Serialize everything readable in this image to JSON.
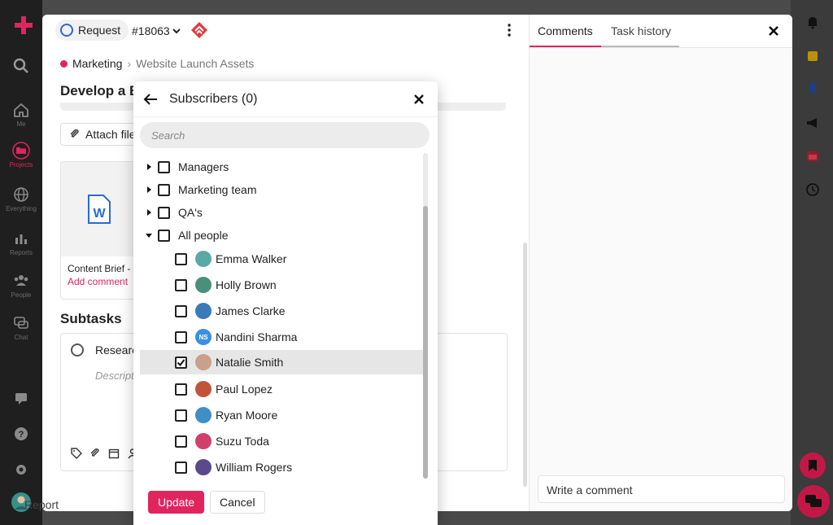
{
  "colors": {
    "accent": "#e0245e",
    "link_blue": "#2a6ad0"
  },
  "sidebar": {
    "items": [
      {
        "label": "Me",
        "icon": "home-icon"
      },
      {
        "label": "Projects",
        "icon": "folder-icon"
      },
      {
        "label": "Everything",
        "icon": "globe-icon"
      },
      {
        "label": "Reports",
        "icon": "chart-icon"
      },
      {
        "label": "People",
        "icon": "people-icon"
      },
      {
        "label": "Chat",
        "icon": "chat-icon"
      }
    ]
  },
  "task": {
    "type_label": "Request",
    "number": "#18063",
    "breadcrumb": {
      "project": "Marketing",
      "folder": "Website Launch Assets"
    },
    "title": "Develop a B",
    "attach_label": "Attach file",
    "file": {
      "name": "Content Brief -",
      "add_comment": "Add comment"
    },
    "subtasks_heading": "Subtasks",
    "subtask": {
      "title": "Research",
      "description_placeholder": "Descripti"
    },
    "report_label": "Report"
  },
  "panel": {
    "tabs": [
      {
        "label": "Comments"
      },
      {
        "label": "Task history"
      }
    ],
    "comment_placeholder": "Write a comment"
  },
  "modal": {
    "title": "Subscribers (0)",
    "search_placeholder": "Search",
    "groups": [
      {
        "label": "Managers",
        "expanded": false
      },
      {
        "label": "Marketing team",
        "expanded": false
      },
      {
        "label": "QA's",
        "expanded": false
      },
      {
        "label": "All people",
        "expanded": true
      }
    ],
    "people": [
      {
        "name": "Emma Walker",
        "checked": false,
        "avatar_color": "#5aa9a6"
      },
      {
        "name": "Holly Brown",
        "checked": false,
        "avatar_color": "#4a8f7a"
      },
      {
        "name": "James Clarke",
        "checked": false,
        "avatar_color": "#3a7ab8"
      },
      {
        "name": "Nandini Sharma",
        "checked": false,
        "avatar_color": "#3c8fe0",
        "initials": "NS"
      },
      {
        "name": "Natalie Smith",
        "checked": true,
        "avatar_color": "#c9a08a"
      },
      {
        "name": "Paul Lopez",
        "checked": false,
        "avatar_color": "#c0543a"
      },
      {
        "name": "Ryan Moore",
        "checked": false,
        "avatar_color": "#3f8fc6"
      },
      {
        "name": "Suzu Toda",
        "checked": false,
        "avatar_color": "#d0406a"
      },
      {
        "name": "William Rogers",
        "checked": false,
        "avatar_color": "#5a4a8a"
      }
    ],
    "update_label": "Update",
    "cancel_label": "Cancel"
  }
}
